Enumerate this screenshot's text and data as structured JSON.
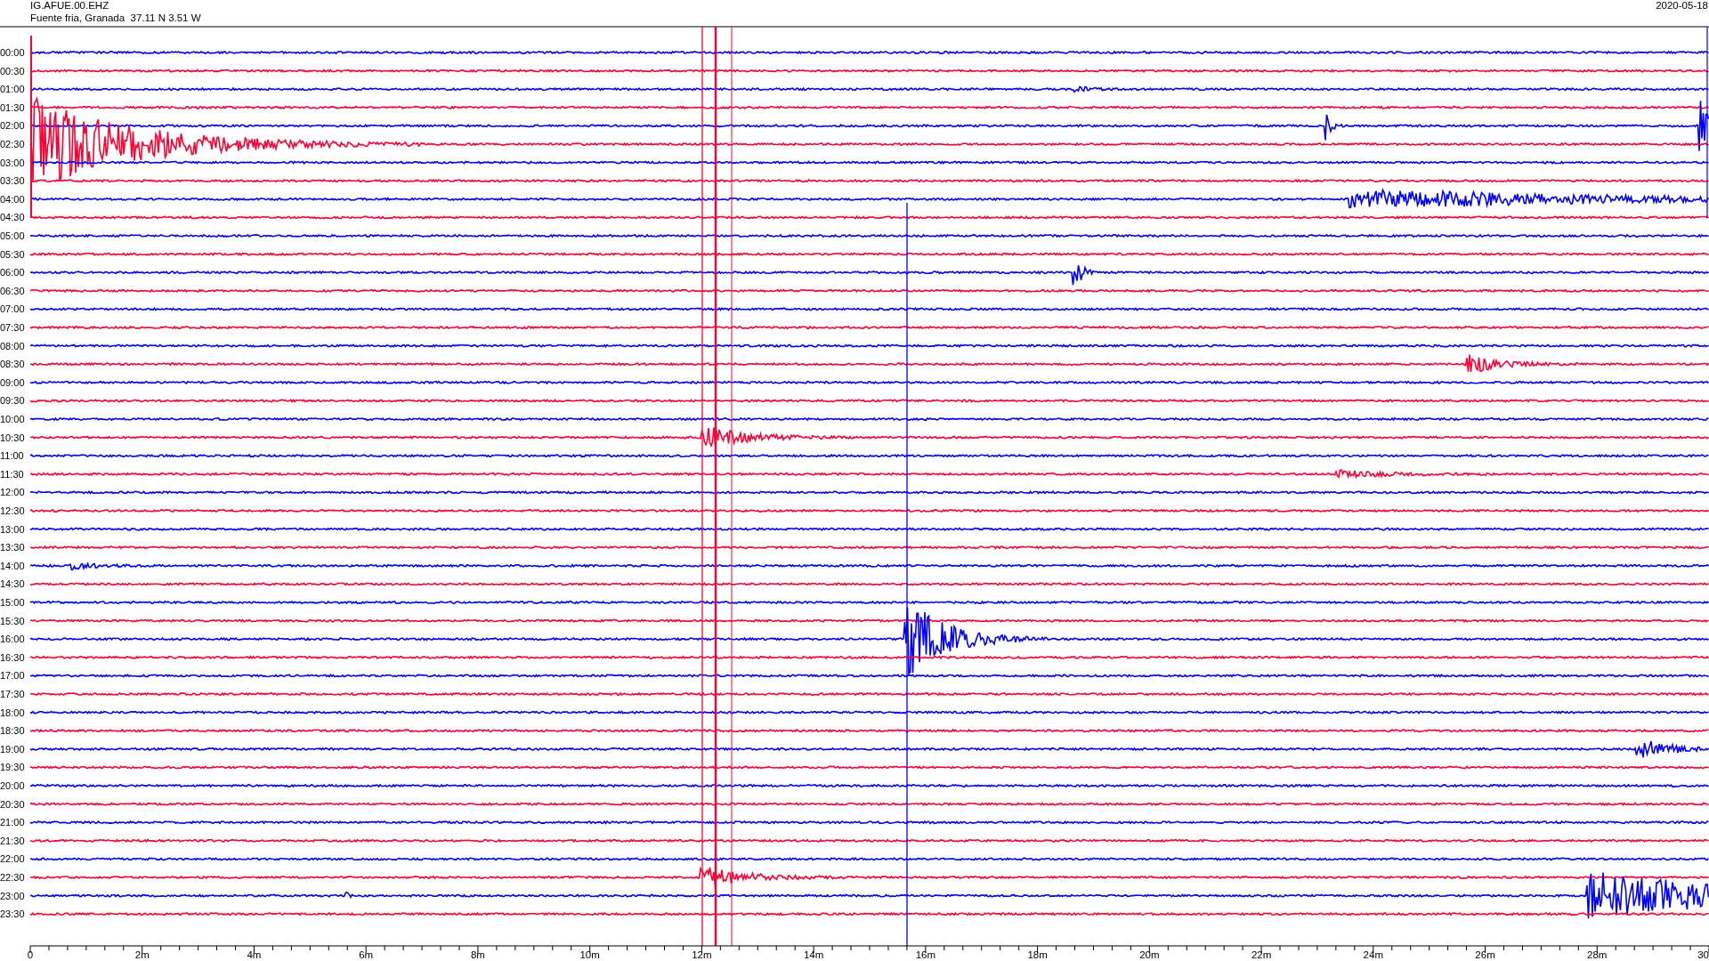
{
  "header": {
    "station": "IG.AFUE.00.EHZ",
    "location": "Fuente fria, Granada  37.11 N 3.51 W",
    "date": "2020-05-18"
  },
  "rows": [
    {
      "label": "00:00",
      "color": "#0000ff"
    },
    {
      "label": "00:30",
      "color": "#ff0033"
    },
    {
      "label": "01:00",
      "color": "#0000ff"
    },
    {
      "label": "01:30",
      "color": "#ff0033"
    },
    {
      "label": "02:00",
      "color": "#0000ff"
    },
    {
      "label": "02:30",
      "color": "#ff0033"
    },
    {
      "label": "03:00",
      "color": "#0000ff"
    },
    {
      "label": "03:30",
      "color": "#ff0033"
    },
    {
      "label": "04:00",
      "color": "#0000ff"
    },
    {
      "label": "04:30",
      "color": "#ff0033"
    },
    {
      "label": "05:00",
      "color": "#0000ff"
    },
    {
      "label": "05:30",
      "color": "#ff0033"
    },
    {
      "label": "06:00",
      "color": "#0000ff"
    },
    {
      "label": "06:30",
      "color": "#ff0033"
    },
    {
      "label": "07:00",
      "color": "#0000ff"
    },
    {
      "label": "07:30",
      "color": "#ff0033"
    },
    {
      "label": "08:00",
      "color": "#0000ff"
    },
    {
      "label": "08:30",
      "color": "#ff0033"
    },
    {
      "label": "09:00",
      "color": "#0000ff"
    },
    {
      "label": "09:30",
      "color": "#ff0033"
    },
    {
      "label": "10:00",
      "color": "#0000ff"
    },
    {
      "label": "10:30",
      "color": "#ff0033"
    },
    {
      "label": "11:00",
      "color": "#0000ff"
    },
    {
      "label": "11:30",
      "color": "#ff0033"
    },
    {
      "label": "12:00",
      "color": "#0000ff"
    },
    {
      "label": "12:30",
      "color": "#ff0033"
    },
    {
      "label": "13:00",
      "color": "#0000ff"
    },
    {
      "label": "13:30",
      "color": "#ff0033"
    },
    {
      "label": "14:00",
      "color": "#0000ff"
    },
    {
      "label": "14:30",
      "color": "#ff0033"
    },
    {
      "label": "15:00",
      "color": "#0000ff"
    },
    {
      "label": "15:30",
      "color": "#ff0033"
    },
    {
      "label": "16:00",
      "color": "#0000ff"
    },
    {
      "label": "16:30",
      "color": "#ff0033"
    },
    {
      "label": "17:00",
      "color": "#0000ff"
    },
    {
      "label": "17:30",
      "color": "#ff0033"
    },
    {
      "label": "18:00",
      "color": "#0000ff"
    },
    {
      "label": "18:30",
      "color": "#ff0033"
    },
    {
      "label": "19:00",
      "color": "#0000ff"
    },
    {
      "label": "19:30",
      "color": "#ff0033"
    },
    {
      "label": "20:00",
      "color": "#0000ff"
    },
    {
      "label": "20:30",
      "color": "#ff0033"
    },
    {
      "label": "21:00",
      "color": "#0000ff"
    },
    {
      "label": "21:30",
      "color": "#ff0033"
    },
    {
      "label": "22:00",
      "color": "#0000ff"
    },
    {
      "label": "22:30",
      "color": "#ff0033"
    },
    {
      "label": "23:00",
      "color": "#0000ff"
    },
    {
      "label": "23:30",
      "color": "#ff0033"
    }
  ],
  "x_axis": {
    "labels": [
      "0",
      "2m",
      "4m",
      "6m",
      "8m",
      "10m",
      "12m",
      "14m",
      "16m",
      "18m",
      "20m",
      "22m",
      "24m",
      "26m",
      "28m",
      "30"
    ]
  }
}
